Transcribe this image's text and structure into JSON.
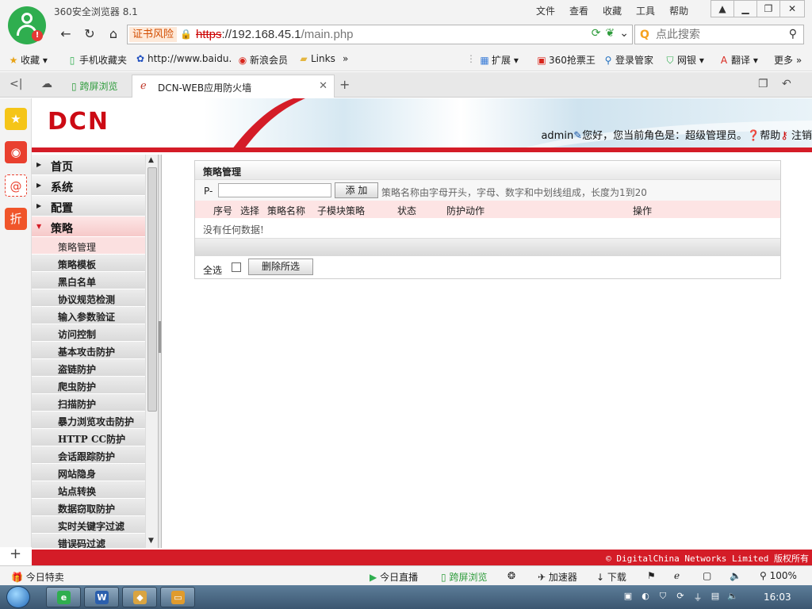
{
  "browser": {
    "title": "360安全浏览器 8.1",
    "menu": [
      "文件",
      "查看",
      "收藏",
      "工具",
      "帮助"
    ],
    "address": {
      "cert_warning": "证书风险",
      "url_protocol": "https",
      "url_host": "://192.168.45.1",
      "url_path": "/main.php"
    },
    "search_placeholder": "点此搜索",
    "bookmarks": {
      "favorites": "收藏",
      "mobile": "手机收藏夹",
      "baidu": "http://www.baidu.",
      "sina": "新浪会员",
      "links": "Links",
      "more_arrow": "»",
      "extensions": "扩展",
      "ticket": "360抢票王",
      "login": "登录管家",
      "bank": "网银",
      "translate": "翻译",
      "more": "更多"
    },
    "tabs": {
      "split_view": "跨屏浏览",
      "active_title": "DCN-WEB应用防火墙"
    },
    "status_bar": {
      "daily_deals": "今日特卖",
      "live": "今日直播",
      "split_view": "跨屏浏览",
      "accelerator": "加速器",
      "download": "下载",
      "zoom": "100%"
    }
  },
  "header": {
    "logo": "DCN",
    "username": "admin",
    "greeting": "您好，您当前角色是：超级管理员。",
    "help": "帮助",
    "logout": "注销"
  },
  "menu": {
    "top": [
      "首页",
      "系统",
      "配置"
    ],
    "active_top": "策略",
    "subs": [
      "策略管理",
      "策略模板",
      "黑白名单",
      "协议规范检测",
      "输入参数验证",
      "访问控制",
      "基本攻击防护",
      "盗链防护",
      "爬虫防护",
      "扫描防护",
      "暴力浏览攻击防护",
      "HTTP CC防护",
      "会话跟踪防护",
      "网站隐身",
      "站点转换",
      "数据窃取防护",
      "实时关键字过滤",
      "错误码过滤"
    ]
  },
  "panel": {
    "title": "策略管理",
    "prefix": "P-",
    "add_button": "添 加",
    "hint": "策略名称由字母开头，字母、数字和中划线组成，长度为1到20",
    "columns": {
      "index": "序号",
      "select": "选择",
      "name": "策略名称",
      "submodule": "子模块策略",
      "status": "状态",
      "action": "防护动作",
      "operation": "操作"
    },
    "empty": "没有任何数据!",
    "select_all": "全选",
    "delete_button": "删除所选"
  },
  "footer": {
    "copyright": "© DigitalChina Networks Limited 版权所有"
  },
  "taskbar": {
    "clock": "16:03"
  },
  "colors": {
    "brand_red": "#d41c27",
    "browser_green": "#2fae4f",
    "table_header": "#fde4e4"
  }
}
